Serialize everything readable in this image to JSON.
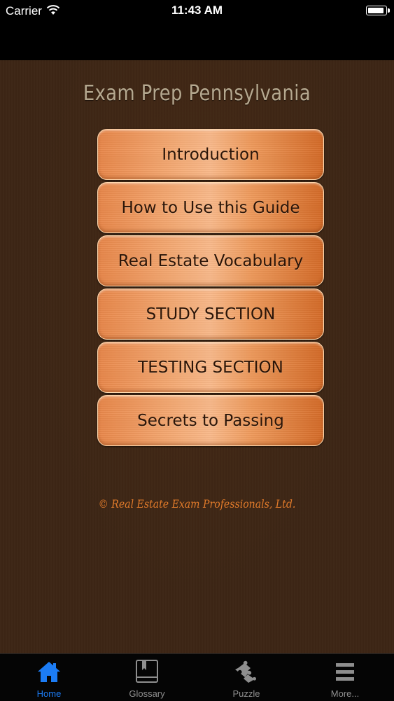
{
  "status_bar": {
    "carrier": "Carrier",
    "time": "11:43 AM",
    "battery_level": 0.95,
    "wifi_icon": "wifi-icon",
    "battery_icon": "battery-icon"
  },
  "app": {
    "title": "Exam Prep Pennsylvania",
    "copyright": "© Real Estate Exam Professionals, Ltd."
  },
  "menu": {
    "items": [
      {
        "label": "Introduction"
      },
      {
        "label": "How to Use this Guide"
      },
      {
        "label": "Real Estate Vocabulary"
      },
      {
        "label": "STUDY SECTION"
      },
      {
        "label": "TESTING SECTION"
      },
      {
        "label": "Secrets to Passing"
      }
    ]
  },
  "tab_bar": {
    "active_color": "#1c7cf4",
    "inactive_color": "#8e8e8e",
    "tabs": [
      {
        "label": "Home",
        "icon": "home-icon",
        "active": true
      },
      {
        "label": "Glossary",
        "icon": "book-icon",
        "active": false
      },
      {
        "label": "Puzzle",
        "icon": "puzzle-icon",
        "active": false
      },
      {
        "label": "More...",
        "icon": "menu-icon",
        "active": false
      }
    ]
  }
}
